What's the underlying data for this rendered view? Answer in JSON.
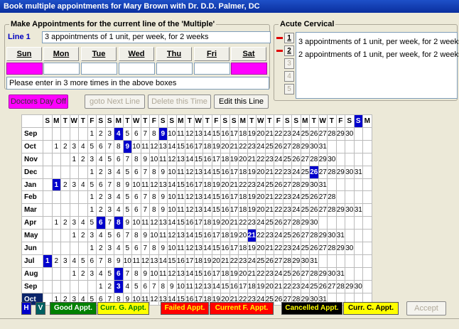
{
  "window": {
    "title": "Book multiple appointments for  Mary Brown with Dr. D.D. Palmer, DC"
  },
  "make_group": {
    "title": "Make Appointments for the current line of the 'Multiple'",
    "line_label": "Line 1",
    "line_description": "3 appointments of 1 unit, per week, for 2 weeks",
    "days": [
      {
        "label": "Sun",
        "value": "",
        "off": true
      },
      {
        "label": "Mon",
        "value": "",
        "off": false
      },
      {
        "label": "Tue",
        "value": "",
        "off": false
      },
      {
        "label": "Wed",
        "value": "",
        "off": false
      },
      {
        "label": "Thu",
        "value": "",
        "off": false
      },
      {
        "label": "Fri",
        "value": "",
        "off": false
      },
      {
        "label": "Sat",
        "value": "",
        "off": true
      }
    ],
    "message": "Please enter in 3 more times in the above boxes"
  },
  "acute": {
    "title": "Acute Cervical",
    "items": [
      "3 appointments of 1 unit, per week, for 2 weeks",
      "2 appointments of 1 unit, per week, for 2 weeks"
    ],
    "line_numbers": [
      "1",
      "2",
      "3",
      "4",
      "5"
    ]
  },
  "buttons": {
    "doctors_day_off": "Doctors Day Off",
    "goto_next_line": "goto Next Line",
    "delete_this_time": "Delete this Time",
    "edit_this_line": "Edit this Line",
    "accept": "Accept"
  },
  "calendar": {
    "header_days": [
      "S",
      "M",
      "T",
      "W",
      "T",
      "F",
      "S",
      "S",
      "M",
      "T",
      "W",
      "T",
      "F",
      "S",
      "S",
      "M",
      "T",
      "W",
      "T",
      "F",
      "S",
      "S",
      "M",
      "T",
      "W",
      "T",
      "F",
      "S",
      "S",
      "M",
      "T",
      "W",
      "T",
      "F",
      "S",
      "S",
      "M"
    ],
    "highlight_header_col": 35,
    "months": [
      {
        "name": "Sep",
        "offset": 5,
        "days": 30,
        "hl": [
          4,
          9
        ]
      },
      {
        "name": "Oct",
        "offset": 1,
        "days": 31,
        "hl": [
          9
        ]
      },
      {
        "name": "Nov",
        "offset": 3,
        "days": 30,
        "hl": []
      },
      {
        "name": "Dec",
        "offset": 5,
        "days": 31,
        "hl": [
          26
        ]
      },
      {
        "name": "Jan",
        "offset": 1,
        "days": 31,
        "hl": [
          1
        ]
      },
      {
        "name": "Feb",
        "offset": 5,
        "days": 28,
        "hl": []
      },
      {
        "name": "Mar",
        "offset": 5,
        "days": 31,
        "hl": []
      },
      {
        "name": "Apr",
        "offset": 1,
        "days": 30,
        "hl": [
          6,
          8
        ]
      },
      {
        "name": "May",
        "offset": 3,
        "days": 31,
        "hl": [
          21
        ]
      },
      {
        "name": "Jun",
        "offset": 5,
        "days": 30,
        "hl": []
      },
      {
        "name": "Jul",
        "offset": 0,
        "days": 31,
        "hl": [
          1
        ]
      },
      {
        "name": "Aug",
        "offset": 3,
        "days": 31,
        "hl": [
          6
        ]
      },
      {
        "name": "Sep",
        "offset": 6,
        "days": 30,
        "hl": [
          3
        ]
      },
      {
        "name": "Oct",
        "offset": 1,
        "days": 31,
        "hl": [],
        "current": true
      }
    ]
  },
  "legend": {
    "h": "H",
    "v": "V",
    "good": "Good Appt.",
    "curr_g": "Curr. G. Appt.",
    "failed": "Failed Appt.",
    "current_f": "Current F. Appt.",
    "cancelled": "Cancelled Appt.",
    "curr_c": "Curr. C. Appt."
  },
  "colors": {
    "day_off": "#ff00ff",
    "good": "#008000",
    "curr_g_bg": "#ffff00",
    "failed": "#ff0000",
    "current_f_bg": "#ff0000",
    "cancelled": "#000000",
    "calendar_highlight": "#0000cc"
  }
}
